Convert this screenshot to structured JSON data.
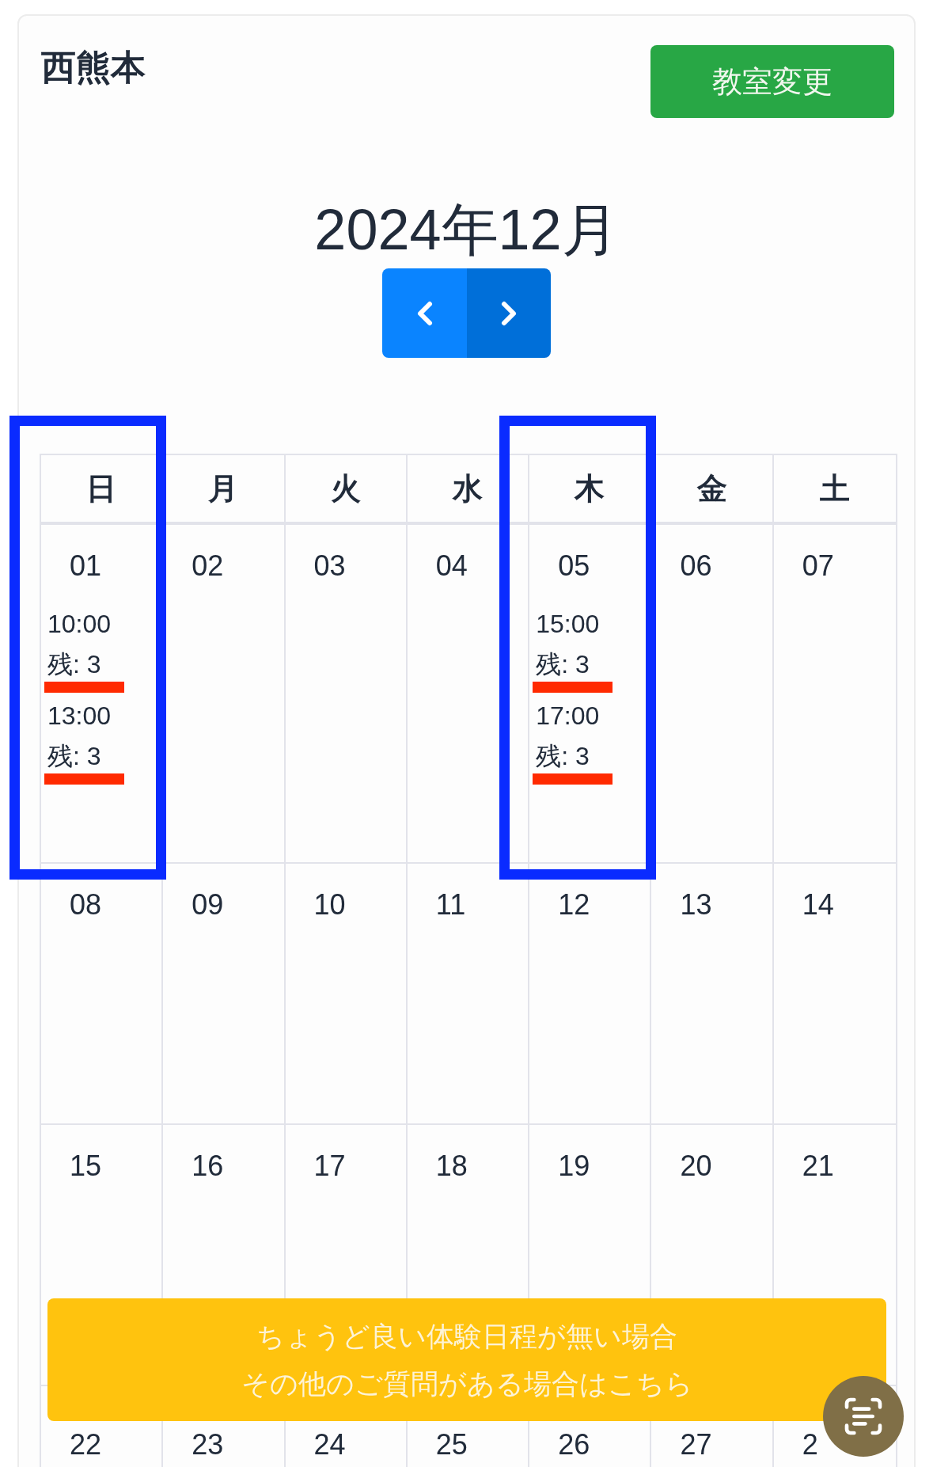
{
  "header": {
    "school": "西熊本",
    "change_button": "教室変更"
  },
  "calendar": {
    "month": "2024年12月",
    "weekdays": [
      {
        "label": "日",
        "framed": true
      },
      {
        "label": "月",
        "framed": false
      },
      {
        "label": "火",
        "framed": false
      },
      {
        "label": "水",
        "framed": false
      },
      {
        "label": "木",
        "framed": true
      },
      {
        "label": "金",
        "framed": false
      },
      {
        "label": "土",
        "framed": false
      }
    ],
    "weeks": [
      [
        {
          "date": "01",
          "slots": [
            {
              "time": "10:00",
              "remaining": "残: 3",
              "underlined": true
            },
            {
              "time": "13:00",
              "remaining": "残: 3",
              "underlined": true
            }
          ]
        },
        {
          "date": "02"
        },
        {
          "date": "03"
        },
        {
          "date": "04"
        },
        {
          "date": "05",
          "slots": [
            {
              "time": "15:00",
              "remaining": "残: 3",
              "underlined": true
            },
            {
              "time": "17:00",
              "remaining": "残: 3",
              "underlined": true
            }
          ]
        },
        {
          "date": "06"
        },
        {
          "date": "07"
        }
      ],
      [
        {
          "date": "08"
        },
        {
          "date": "09"
        },
        {
          "date": "10"
        },
        {
          "date": "11"
        },
        {
          "date": "12"
        },
        {
          "date": "13"
        },
        {
          "date": "14"
        }
      ],
      [
        {
          "date": "15"
        },
        {
          "date": "16"
        },
        {
          "date": "17"
        },
        {
          "date": "18"
        },
        {
          "date": "19"
        },
        {
          "date": "20"
        },
        {
          "date": "21"
        }
      ],
      [
        {
          "date": "22"
        },
        {
          "date": "23"
        },
        {
          "date": "24"
        },
        {
          "date": "25"
        },
        {
          "date": "26"
        },
        {
          "date": "27"
        },
        {
          "date": "2"
        }
      ]
    ]
  },
  "contact_banner": {
    "lines": [
      "ちょうど良い体験日程が無い場合",
      "その他のご質問がある場合はこちら"
    ]
  }
}
